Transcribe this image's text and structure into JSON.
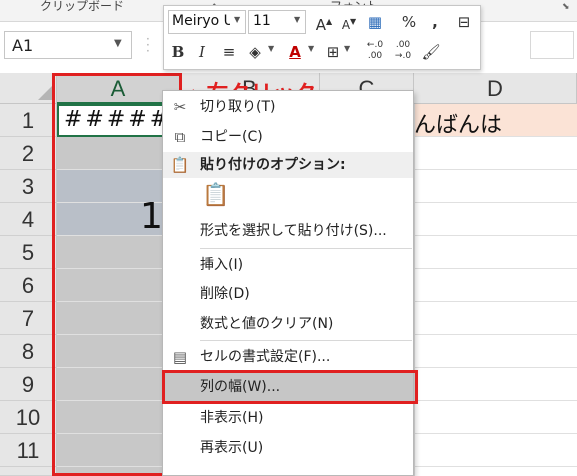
{
  "ribbon": {
    "clipboard_group": "クリップボード",
    "font_group": "フォント"
  },
  "name_box": {
    "value": "A1"
  },
  "columns": [
    "A",
    "B",
    "C",
    "D"
  ],
  "rows": [
    "1",
    "2",
    "3",
    "4",
    "5",
    "6",
    "7",
    "8",
    "9",
    "10",
    "11"
  ],
  "cells": {
    "a1": "#######",
    "merged_value": "1",
    "c1": "こんばんは"
  },
  "annotation": {
    "label": "←右クリック"
  },
  "mini_toolbar": {
    "font_name": "Meiryo U",
    "font_size": "11"
  },
  "context_menu": {
    "cut": "切り取り(T)",
    "copy": "コピー(C)",
    "paste_options": "貼り付けのオプション:",
    "paste_special": "形式を選択して貼り付け(S)...",
    "insert": "挿入(I)",
    "delete": "削除(D)",
    "clear_contents": "数式と値のクリア(N)",
    "format_cells": "セルの書式設定(F)...",
    "column_width": "列の幅(W)...",
    "hide": "非表示(H)",
    "unhide": "再表示(U)"
  },
  "colors": {
    "excel_green": "#217346",
    "annotation_red": "#e02020",
    "row1_highlight": "#fbe3d6"
  }
}
